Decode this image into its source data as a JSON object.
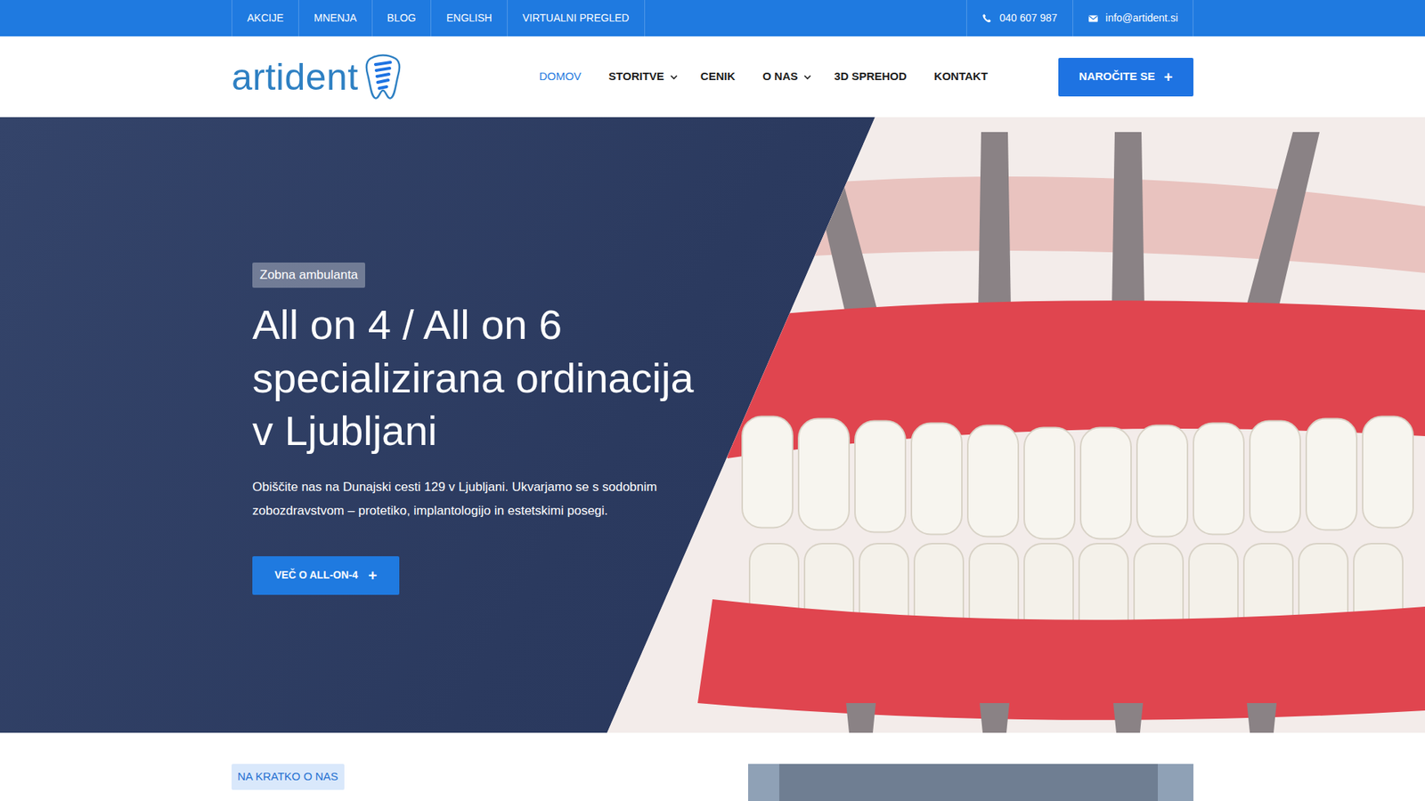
{
  "topbar": {
    "links": [
      "AKCIJE",
      "MNENJA",
      "BLOG",
      "ENGLISH",
      "VIRTUALNI PREGLED"
    ],
    "phone": "040 607 987",
    "email": "info@artident.si"
  },
  "logo": {
    "text": "artident"
  },
  "nav": {
    "items": [
      {
        "label": "DOMOV",
        "selected": true,
        "dropdown": false
      },
      {
        "label": "STORITVE",
        "selected": false,
        "dropdown": true
      },
      {
        "label": "CENIK",
        "selected": false,
        "dropdown": false
      },
      {
        "label": "O NAS",
        "selected": false,
        "dropdown": true
      },
      {
        "label": "3D SPREHOD",
        "selected": false,
        "dropdown": false
      },
      {
        "label": "KONTAKT",
        "selected": false,
        "dropdown": false
      }
    ],
    "cta": {
      "label": "NAROČITE SE",
      "icon": "+"
    }
  },
  "hero": {
    "badge": "Zobna ambulanta",
    "title_lines": [
      "All on 4 / All on 6",
      "specializirana ordinacija",
      "v Ljubljani"
    ],
    "text": "Obiščite nas na Dunajski cesti 129 v Ljubljani. Ukvarjamo se s sodobnim zobozdravstvom – protetiko, implantologijo in estetskimi posegi.",
    "button": {
      "label": "VEČ O ALL-ON-4",
      "icon": "+"
    }
  },
  "about": {
    "badge": "NA KRATKO O NAS"
  }
}
